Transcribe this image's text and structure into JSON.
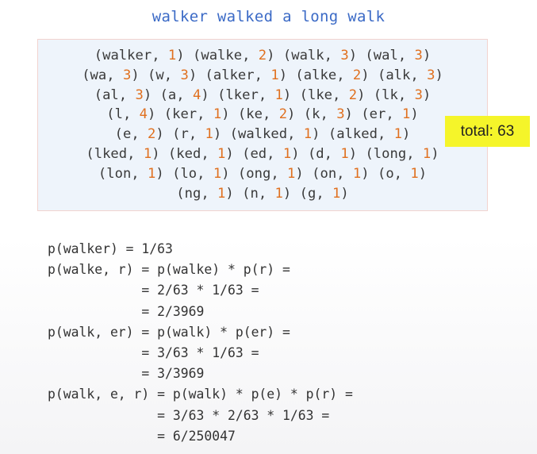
{
  "title": "walker walked a long walk",
  "tokens": [
    [
      "walker",
      "1"
    ],
    [
      "walke",
      "2"
    ],
    [
      "walk",
      "3"
    ],
    [
      "wal",
      "3"
    ],
    [
      "wa",
      "3"
    ],
    [
      "w",
      "3"
    ],
    [
      "alker",
      "1"
    ],
    [
      "alke",
      "2"
    ],
    [
      "alk",
      "3"
    ],
    [
      "al",
      "3"
    ],
    [
      "a",
      "4"
    ],
    [
      "lker",
      "1"
    ],
    [
      "lke",
      "2"
    ],
    [
      "lk",
      "3"
    ],
    [
      "l",
      "4"
    ],
    [
      "ker",
      "1"
    ],
    [
      "ke",
      "2"
    ],
    [
      "k",
      "3"
    ],
    [
      "er",
      "1"
    ],
    [
      "e",
      "2"
    ],
    [
      "r",
      "1"
    ],
    [
      "walked",
      "1"
    ],
    [
      "alked",
      "1"
    ],
    [
      "lked",
      "1"
    ],
    [
      "ked",
      "1"
    ],
    [
      "ed",
      "1"
    ],
    [
      "d",
      "1"
    ],
    [
      "long",
      "1"
    ],
    [
      "lon",
      "1"
    ],
    [
      "lo",
      "1"
    ],
    [
      "ong",
      "1"
    ],
    [
      "on",
      "1"
    ],
    [
      "o",
      "1"
    ],
    [
      "ng",
      "1"
    ],
    [
      "n",
      "1"
    ],
    [
      "g",
      "1"
    ]
  ],
  "token_lines": [
    4,
    5,
    5,
    5,
    4,
    5,
    5,
    3
  ],
  "total_label": "total: 63",
  "calculations": [
    "p(walker) = 1/63",
    "p(walke, r) = p(walke) * p(r) =",
    "            = 2/63 * 1/63 =",
    "            = 2/3969",
    "p(walk, er) = p(walk) * p(er) =",
    "            = 3/63 * 1/63 =",
    "            = 3/3969",
    "p(walk, e, r) = p(walk) * p(e) * p(r) =",
    "              = 3/63 * 2/63 * 1/63 =",
    "              = 6/250047"
  ]
}
